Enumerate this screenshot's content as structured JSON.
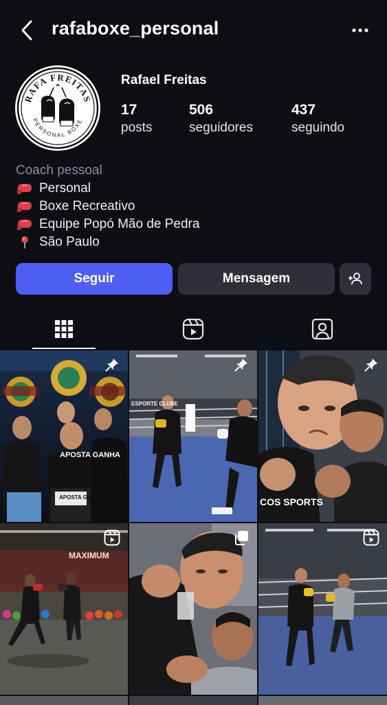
{
  "header": {
    "username": "rafaboxe_personal",
    "back_icon": "chevron-left-icon",
    "more_icon": "more-horizontal-icon"
  },
  "profile": {
    "avatar": {
      "logo_text_top": "RAFA FREITAS",
      "logo_text_bottom": "PERSONAL BOXE"
    },
    "display_name": "Rafael Freitas",
    "stats": {
      "posts": {
        "value": "17",
        "label": "posts"
      },
      "followers": {
        "value": "506",
        "label": "seguidores"
      },
      "following": {
        "value": "437",
        "label": "seguindo"
      }
    }
  },
  "bio": {
    "category": "Coach pessoal",
    "lines": [
      {
        "icon": "boxing-glove-icon",
        "text": "Personal"
      },
      {
        "icon": "boxing-glove-icon",
        "text": "Boxe Recreativo"
      },
      {
        "icon": "boxing-glove-icon",
        "text": "Equipe Popó Mão de Pedra"
      },
      {
        "icon": "location-pin-icon",
        "text": "São Paulo"
      }
    ]
  },
  "actions": {
    "follow_label": "Seguir",
    "message_label": "Mensagem",
    "add_icon": "add-person-icon"
  },
  "colors": {
    "background": "#0d0d14",
    "follow_button": "#4f5ef2",
    "secondary_button": "#2e2f38",
    "muted_text": "#8e8e98"
  },
  "tabs": [
    {
      "name": "grid",
      "icon": "grid-icon",
      "active": true
    },
    {
      "name": "reels",
      "icon": "reels-icon",
      "active": false
    },
    {
      "name": "tagged",
      "icon": "tagged-person-icon",
      "active": false
    }
  ],
  "posts": [
    {
      "overlay": "pin-icon",
      "caption_1": "APOSTA GANHA",
      "caption_2": "APOSTA GANHA"
    },
    {
      "overlay": "pin-icon",
      "caption_1": "ESPORTE CLUBE"
    },
    {
      "overlay": "pin-icon",
      "caption_1": "COS SPORTS"
    },
    {
      "overlay": "reels-icon",
      "caption_1": "MAXIMUM"
    },
    {
      "overlay": "carousel-icon"
    },
    {
      "overlay": "reels-icon"
    }
  ]
}
